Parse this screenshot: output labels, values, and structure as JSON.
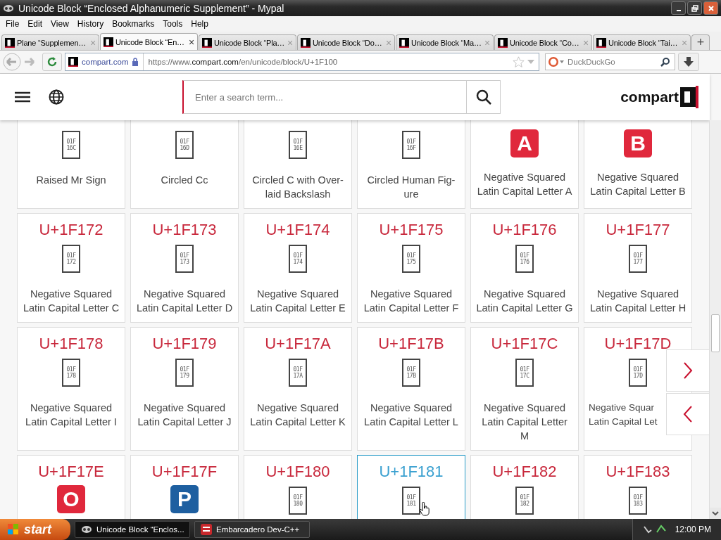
{
  "window": {
    "title": "Unicode Block “Enclosed Alphanumeric Supplement” - Mypal"
  },
  "menu": [
    "File",
    "Edit",
    "View",
    "History",
    "Bookmarks",
    "Tools",
    "Help"
  ],
  "tabs": [
    {
      "label": "Plane “Supplemen…",
      "selected": false
    },
    {
      "label": "Unicode Block “En…",
      "selected": true
    },
    {
      "label": "Unicode Block “Pla…",
      "selected": false
    },
    {
      "label": "Unicode Block “Do…",
      "selected": false
    },
    {
      "label": "Unicode Block “Ma…",
      "selected": false
    },
    {
      "label": "Unicode Block “Co…",
      "selected": false
    },
    {
      "label": "Unicode Block “Tai…",
      "selected": false
    }
  ],
  "tab_close": "×",
  "new_tab": "+",
  "address_bar": {
    "site": "compart.com",
    "url": "https://www.**compart.com**/en/unicode/block/U+1F100"
  },
  "search_bar": {
    "placeholder": "DuckDuckGo"
  },
  "page_header": {
    "search_placeholder": "Enter a search term...",
    "logo": "compart"
  },
  "cards": [
    {
      "glyph": {
        "kind": "hexbox",
        "hex": [
          "01F",
          "16C"
        ]
      },
      "name_lines": [
        "Raised Mr Sign"
      ],
      "selected": false
    },
    {
      "glyph": {
        "kind": "hexbox",
        "hex": [
          "01F",
          "16D"
        ]
      },
      "name_lines": [
        "Circled Cc"
      ],
      "selected": false
    },
    {
      "glyph": {
        "kind": "hexbox",
        "hex": [
          "01F",
          "16E"
        ]
      },
      "name_lines": [
        "Circled C with Over-",
        "laid Backslash"
      ],
      "selected": false
    },
    {
      "glyph": {
        "kind": "hexbox",
        "hex": [
          "01F",
          "16F"
        ]
      },
      "name_lines": [
        "Circled Human Fig-",
        "ure"
      ],
      "selected": false
    },
    {
      "glyph": {
        "kind": "square",
        "letter": "A",
        "color": "#e0283c"
      },
      "name_lines": [
        "Negative Squared",
        "Latin Capital Letter A"
      ],
      "selected": false
    },
    {
      "glyph": {
        "kind": "square",
        "letter": "B",
        "color": "#e0283c"
      },
      "name_lines": [
        "Negative Squared",
        "Latin Capital Letter B"
      ],
      "selected": false
    },
    {
      "code": "U+1F172",
      "glyph": {
        "kind": "hexbox",
        "hex": [
          "01F",
          "172"
        ]
      },
      "name_lines": [
        "Negative Squared",
        "Latin Capital Letter C"
      ],
      "selected": false
    },
    {
      "code": "U+1F173",
      "glyph": {
        "kind": "hexbox",
        "hex": [
          "01F",
          "173"
        ]
      },
      "name_lines": [
        "Negative Squared",
        "Latin Capital Letter D"
      ],
      "selected": false
    },
    {
      "code": "U+1F174",
      "glyph": {
        "kind": "hexbox",
        "hex": [
          "01F",
          "174"
        ]
      },
      "name_lines": [
        "Negative Squared",
        "Latin Capital Letter E"
      ],
      "selected": false
    },
    {
      "code": "U+1F175",
      "glyph": {
        "kind": "hexbox",
        "hex": [
          "01F",
          "175"
        ]
      },
      "name_lines": [
        "Negative Squared",
        "Latin Capital Letter F"
      ],
      "selected": false
    },
    {
      "code": "U+1F176",
      "glyph": {
        "kind": "hexbox",
        "hex": [
          "01F",
          "176"
        ]
      },
      "name_lines": [
        "Negative Squared",
        "Latin Capital Letter G"
      ],
      "selected": false
    },
    {
      "code": "U+1F177",
      "glyph": {
        "kind": "hexbox",
        "hex": [
          "01F",
          "177"
        ]
      },
      "name_lines": [
        "Negative Squared",
        "Latin Capital Letter H"
      ],
      "selected": false
    },
    {
      "code": "U+1F178",
      "glyph": {
        "kind": "hexbox",
        "hex": [
          "01F",
          "178"
        ]
      },
      "name_lines": [
        "Negative Squared",
        "Latin Capital Letter I"
      ],
      "selected": false
    },
    {
      "code": "U+1F179",
      "glyph": {
        "kind": "hexbox",
        "hex": [
          "01F",
          "179"
        ]
      },
      "name_lines": [
        "Negative Squared",
        "Latin Capital Letter J"
      ],
      "selected": false
    },
    {
      "code": "U+1F17A",
      "glyph": {
        "kind": "hexbox",
        "hex": [
          "01F",
          "17A"
        ]
      },
      "name_lines": [
        "Negative Squared",
        "Latin Capital Letter K"
      ],
      "selected": false
    },
    {
      "code": "U+1F17B",
      "glyph": {
        "kind": "hexbox",
        "hex": [
          "01F",
          "17B"
        ]
      },
      "name_lines": [
        "Negative Squared",
        "Latin Capital Letter L"
      ],
      "selected": false
    },
    {
      "code": "U+1F17C",
      "glyph": {
        "kind": "hexbox",
        "hex": [
          "01F",
          "17C"
        ]
      },
      "name_lines": [
        "Negative Squared",
        "Latin Capital Letter",
        "M"
      ],
      "selected": false
    },
    {
      "code": "U+1F17D",
      "glyph": {
        "kind": "hexbox",
        "hex": [
          "01F",
          "17D"
        ]
      },
      "name_lines": [
        "Negative Squar",
        "Latin Capital Let"
      ],
      "covered": true,
      "selected": false
    },
    {
      "code": "U+1F17E",
      "glyph": {
        "kind": "square",
        "letter": "O",
        "color": "#e0283c"
      },
      "selected": false
    },
    {
      "code": "U+1F17F",
      "glyph": {
        "kind": "square",
        "letter": "P",
        "color": "#1e5fa0"
      },
      "selected": false
    },
    {
      "code": "U+1F180",
      "glyph": {
        "kind": "hexbox",
        "hex": [
          "01F",
          "180"
        ]
      },
      "selected": false
    },
    {
      "code": "U+1F181",
      "glyph": {
        "kind": "hexbox",
        "hex": [
          "01F",
          "181"
        ]
      },
      "selected": true
    },
    {
      "code": "U+1F182",
      "glyph": {
        "kind": "hexbox",
        "hex": [
          "01F",
          "182"
        ]
      },
      "selected": false
    },
    {
      "code": "U+1F183",
      "glyph": {
        "kind": "hexbox",
        "hex": [
          "01F",
          "183"
        ]
      },
      "selected": false
    }
  ],
  "taskbar": {
    "start": "start",
    "tasks": [
      {
        "label": "Unicode Block “Enclos...",
        "selected": true
      },
      {
        "label": "Embarcadero Dev-C++",
        "selected": false
      }
    ],
    "clock": "12:00 PM"
  }
}
